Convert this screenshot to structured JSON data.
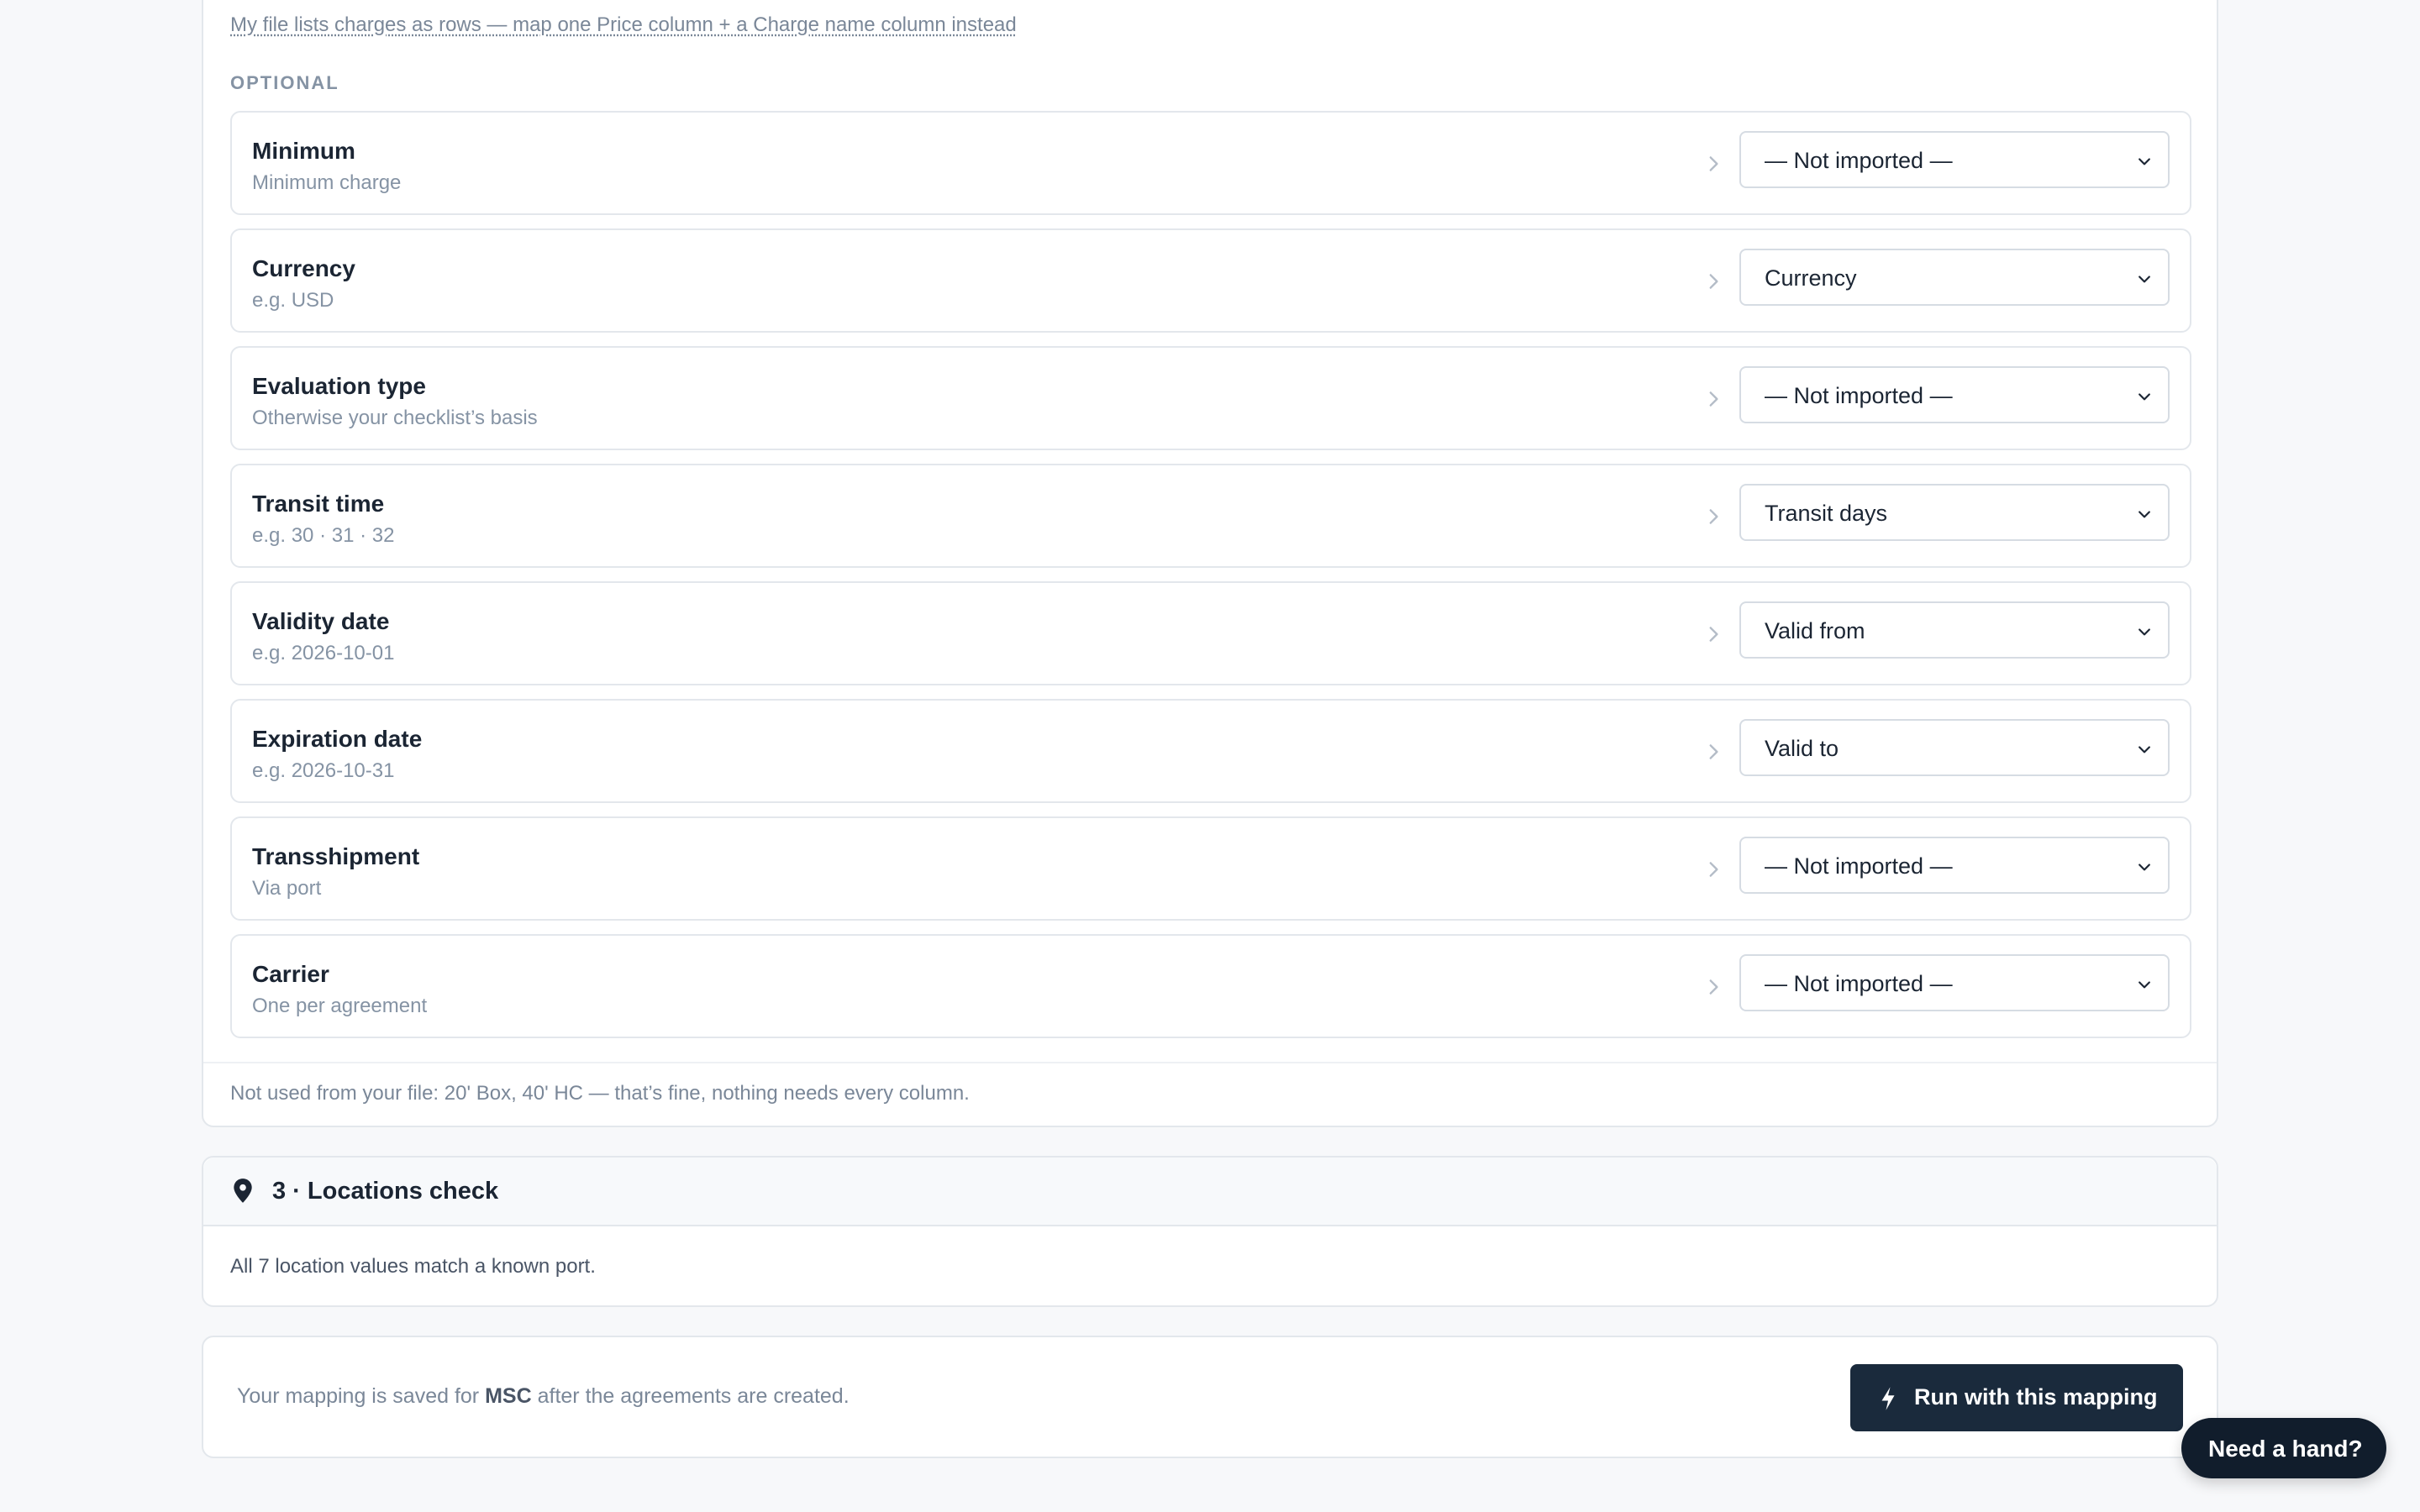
{
  "mapping": {
    "charges_link": "My file lists charges as rows — map one Price column + a Charge name column instead",
    "section_label": "OPTIONAL",
    "fields": [
      {
        "name": "Minimum",
        "hint": "Minimum charge",
        "selected": "— Not imported —"
      },
      {
        "name": "Currency",
        "hint": "e.g. USD",
        "selected": "Currency"
      },
      {
        "name": "Evaluation type",
        "hint": "Otherwise your checklist’s basis",
        "selected": "— Not imported —"
      },
      {
        "name": "Transit time",
        "hint": "e.g. 30 · 31 · 32",
        "selected": "Transit days"
      },
      {
        "name": "Validity date",
        "hint": "e.g. 2026-10-01",
        "selected": "Valid from"
      },
      {
        "name": "Expiration date",
        "hint": "e.g. 2026-10-31",
        "selected": "Valid to"
      },
      {
        "name": "Transshipment",
        "hint": "Via port",
        "selected": "— Not imported —"
      },
      {
        "name": "Carrier",
        "hint": "One per agreement",
        "selected": "— Not imported —"
      }
    ],
    "unused_note": "Not used from your file: 20' Box, 40' HC — that’s fine, nothing needs every column."
  },
  "locations": {
    "title": "3 · Locations check",
    "body": "All 7 location values match a known port.",
    "icon": "map-pin-icon"
  },
  "action": {
    "save_note_prefix": "Your mapping is saved for",
    "carrier": "MSC",
    "save_note_suffix": "after the agreements are created.",
    "run_label": "Run with this mapping",
    "run_icon": "lightning-icon"
  },
  "help": {
    "label": "Need a hand?"
  },
  "colors": {
    "primary_button": "#1a2a3c",
    "help_button": "#111d2c",
    "border": "#e3e7ec",
    "muted_text": "#8593a4"
  }
}
